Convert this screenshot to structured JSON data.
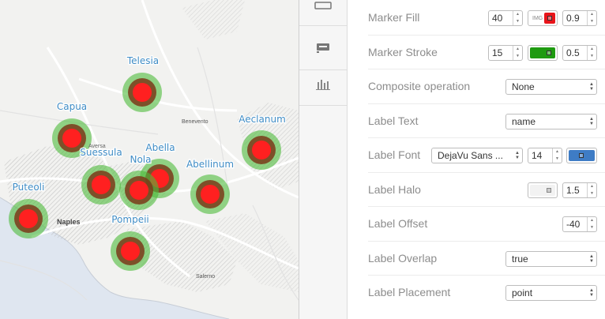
{
  "map": {
    "places": [
      {
        "name": "Telesia"
      },
      {
        "name": "Capua"
      },
      {
        "name": "Suessula"
      },
      {
        "name": "Abella"
      },
      {
        "name": "Nola"
      },
      {
        "name": "Aeclanum"
      },
      {
        "name": "Abellinum"
      },
      {
        "name": "Puteoli"
      },
      {
        "name": "Pompeii"
      }
    ],
    "basemap_labels": [
      "Naples",
      "Benevento",
      "Salerno",
      "Aversa"
    ],
    "marker_colors": {
      "fill": "#ff2020",
      "halo": "#4dbb3a",
      "stroke": "#2d9e1c"
    }
  },
  "toolbar": {
    "buttons": [
      {
        "icon": "layers-icon"
      },
      {
        "icon": "style-icon"
      },
      {
        "icon": "bar-chart-icon"
      }
    ]
  },
  "panel": {
    "marker_fill": {
      "label": "Marker Fill",
      "size": "40",
      "img_tag": "IMG",
      "color": "#e8141a",
      "opacity": "0.9"
    },
    "marker_stroke": {
      "label": "Marker Stroke",
      "width": "15",
      "color": "#1e9a10",
      "opacity": "0.5"
    },
    "composite": {
      "label": "Composite operation",
      "value": "None"
    },
    "label_text": {
      "label": "Label Text",
      "value": "name"
    },
    "label_font": {
      "label": "Label Font",
      "family": "DejaVu Sans ...",
      "size": "14",
      "color": "#3e7cc5"
    },
    "label_halo": {
      "label": "Label Halo",
      "width": "1.5"
    },
    "label_offset": {
      "label": "Label Offset",
      "value": "-40"
    },
    "label_overlap": {
      "label": "Label Overlap",
      "value": "true"
    },
    "label_placement": {
      "label": "Label Placement",
      "value": "point"
    }
  }
}
